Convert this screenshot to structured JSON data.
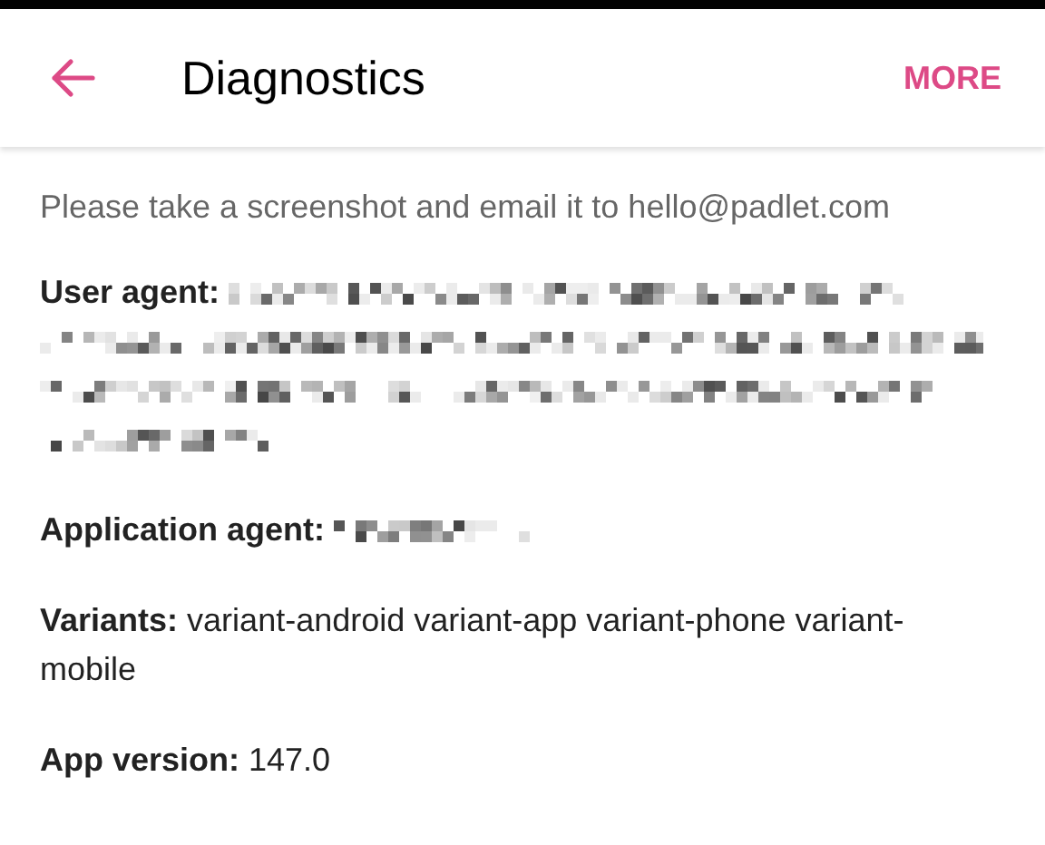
{
  "header": {
    "title": "Diagnostics",
    "action": "MORE"
  },
  "intro": "Please take a screenshot and email it to hello@padlet.com",
  "fields": [
    {
      "kind": "redactedlong",
      "label": "User agent:"
    },
    {
      "kind": "redactedshort",
      "label": "Application agent:"
    },
    {
      "kind": "text",
      "text": "**Variants:** variant-android variant-app variant-phone variant-mobile"
    },
    {
      "kind": "text",
      "text": "**App version:** 147.0"
    }
  ]
}
